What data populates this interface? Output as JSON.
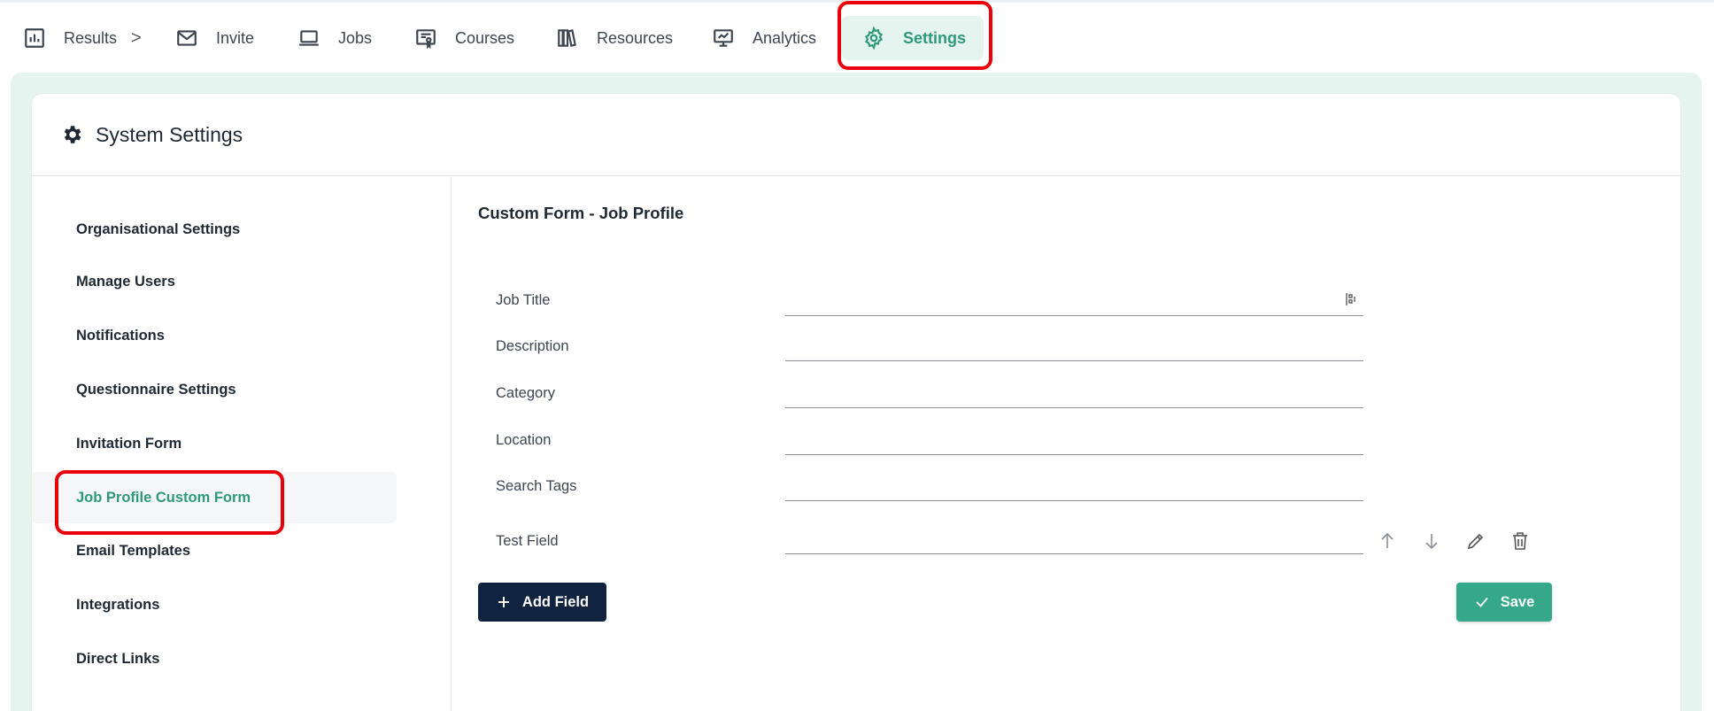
{
  "nav": {
    "items": [
      {
        "label": "Results",
        "icon": "bar-chart-icon"
      },
      {
        "label": "Invite",
        "icon": "mail-icon"
      },
      {
        "label": "Jobs",
        "icon": "laptop-icon"
      },
      {
        "label": "Courses",
        "icon": "certificate-icon"
      },
      {
        "label": "Resources",
        "icon": "books-icon"
      },
      {
        "label": "Analytics",
        "icon": "presentation-chart-icon"
      },
      {
        "label": "Settings",
        "icon": "gear-icon",
        "active": true
      }
    ],
    "breadcrumb_separator": ">"
  },
  "header": {
    "title": "System Settings",
    "icon": "gear-icon"
  },
  "sidebar": {
    "items": [
      {
        "label": "Organisational Settings"
      },
      {
        "label": "Manage Users"
      },
      {
        "label": "Notifications"
      },
      {
        "label": "Questionnaire Settings"
      },
      {
        "label": "Invitation Form"
      },
      {
        "label": "Job Profile Custom Form",
        "active": true
      },
      {
        "label": "Email Templates"
      },
      {
        "label": "Integrations"
      },
      {
        "label": "Direct Links"
      }
    ]
  },
  "form": {
    "title": "Custom Form - Job Profile",
    "fields": [
      {
        "label": "Job Title",
        "value": ""
      },
      {
        "label": "Description",
        "value": ""
      },
      {
        "label": "Category",
        "value": ""
      },
      {
        "label": "Location",
        "value": ""
      },
      {
        "label": "Search Tags",
        "value": ""
      },
      {
        "label": "Test Field",
        "value": ""
      }
    ],
    "add_label": "Add Field",
    "save_label": "Save"
  },
  "colors": {
    "accent": "#2f9a7a",
    "accent_bg": "#e5f4ef",
    "primary_dark": "#10233f",
    "save_green": "#35a889",
    "highlight_red": "#e8000b"
  }
}
